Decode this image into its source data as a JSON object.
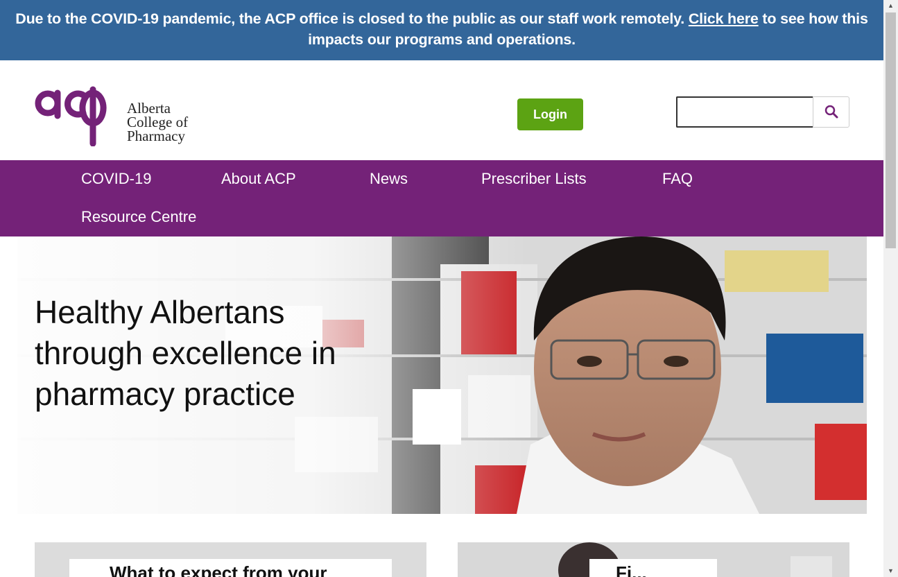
{
  "alert": {
    "text_before": "Due to the COVID-19 pandemic, the ACP office is closed to the public as our staff work remotely. ",
    "link": "Click here",
    "text_after": " to see how this impacts our programs and operations."
  },
  "header": {
    "logo": {
      "mark": "acp",
      "line1": "Alberta",
      "line2": "College of",
      "line3": "Pharmacy"
    },
    "login_label": "Login",
    "search": {
      "placeholder": "",
      "value": ""
    }
  },
  "nav": {
    "items": [
      {
        "label": "COVID-19"
      },
      {
        "label": "About ACP"
      },
      {
        "label": "News"
      },
      {
        "label": "Prescriber Lists"
      },
      {
        "label": "FAQ"
      },
      {
        "label": "Resource Centre"
      }
    ]
  },
  "hero": {
    "title": "Healthy Albertans through excellence in pharmacy practice"
  },
  "cards": [
    {
      "label": "What to expect from your"
    },
    {
      "label": "Fi..."
    }
  ],
  "colors": {
    "alert_bg": "#33669a",
    "brand_purple": "#742278",
    "login_green": "#5ca313"
  },
  "icons": [
    "search-icon",
    "scroll-up-icon",
    "scroll-down-icon"
  ]
}
